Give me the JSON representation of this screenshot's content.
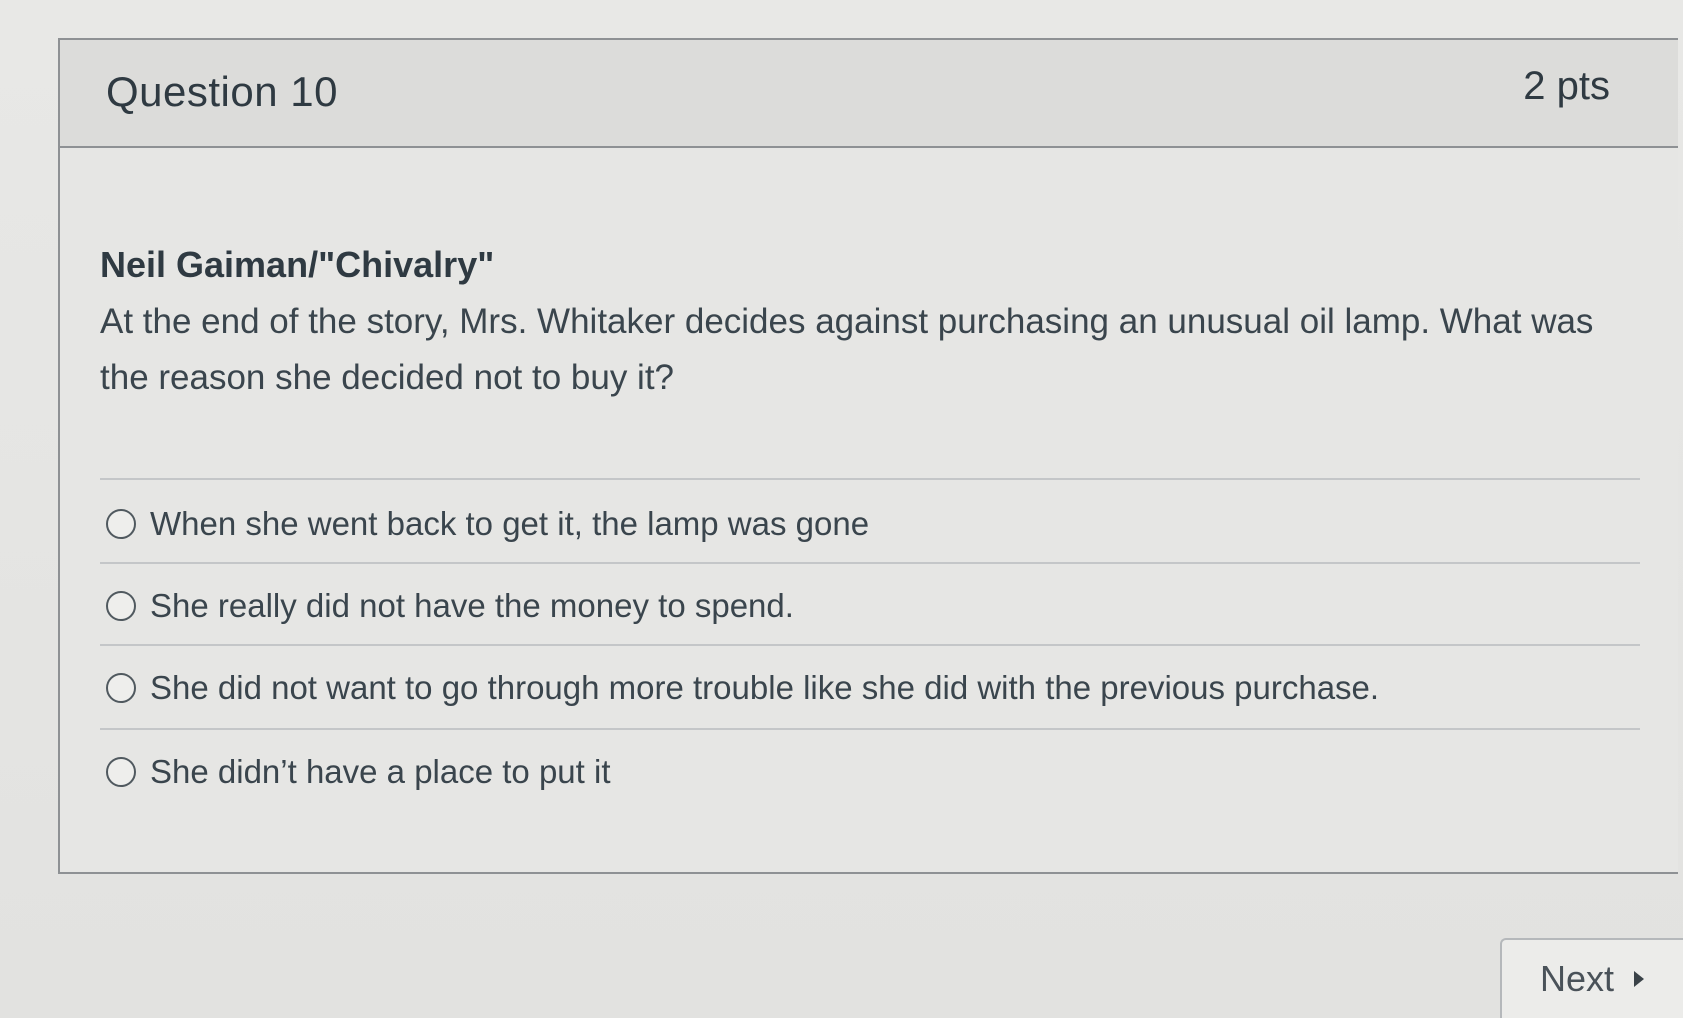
{
  "question": {
    "title": "Question 10",
    "points": "2 pts",
    "subject": "Neil Gaiman/\"Chivalry\"",
    "text": "At the end of the story, Mrs. Whitaker decides against purchasing an unusual oil lamp. What was the reason she decided not to buy it?",
    "answers": [
      {
        "label": "When she went back to get it, the lamp was gone"
      },
      {
        "label": "She really did not have the money to spend."
      },
      {
        "label": "She did not want to go through more trouble like she did with the previous purchase."
      },
      {
        "label": "She didn’t have a place to put it"
      }
    ]
  },
  "navigation": {
    "next_label": "Next",
    "next_icon": "caret-right-icon"
  }
}
